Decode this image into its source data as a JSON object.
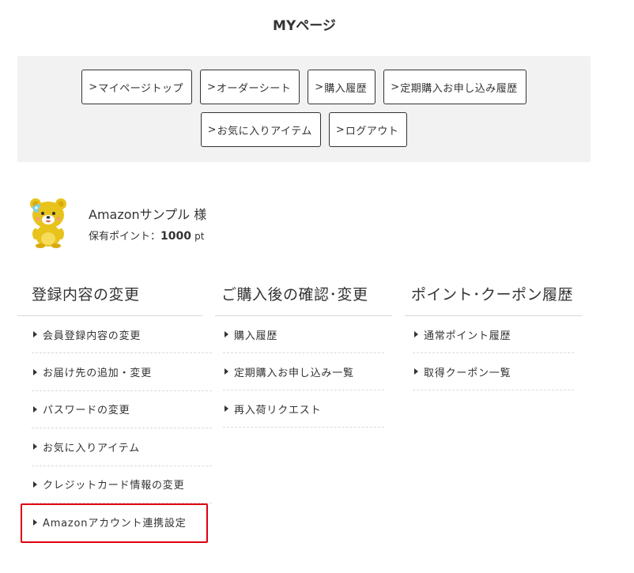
{
  "page": {
    "title": "MYページ"
  },
  "nav": {
    "row1": [
      "マイページトップ",
      "オーダーシート",
      "購入履歴",
      "定期購入お申し込み履歴"
    ],
    "row2": [
      "お気に入りアイテム",
      "ログアウト"
    ],
    "chevron": ">"
  },
  "user": {
    "name": "Amazonサンプル 様",
    "points_label": "保有ポイント：",
    "points_value": "1000",
    "points_unit": "pt",
    "avatar_icon": "bear-mascot-icon"
  },
  "columns": {
    "registration": {
      "title": "登録内容の変更",
      "items": [
        "会員登録内容の変更",
        "お届け先の追加・変更",
        "パスワードの変更",
        "お気に入りアイテム",
        "クレジットカード情報の変更",
        "Amazonアカウント連携設定"
      ]
    },
    "after_purchase": {
      "title": "ご購入後の確認･変更",
      "items": [
        "購入履歴",
        "定期購入お申し込み一覧",
        "再入荷リクエスト"
      ]
    },
    "points": {
      "title": "ポイント･クーポン履歴",
      "items": [
        "通常ポイント履歴",
        "取得クーポン一覧"
      ]
    }
  },
  "colors": {
    "highlight": "#e00010",
    "panel": "#f2f2f2",
    "mascot": "#e8c31c"
  }
}
